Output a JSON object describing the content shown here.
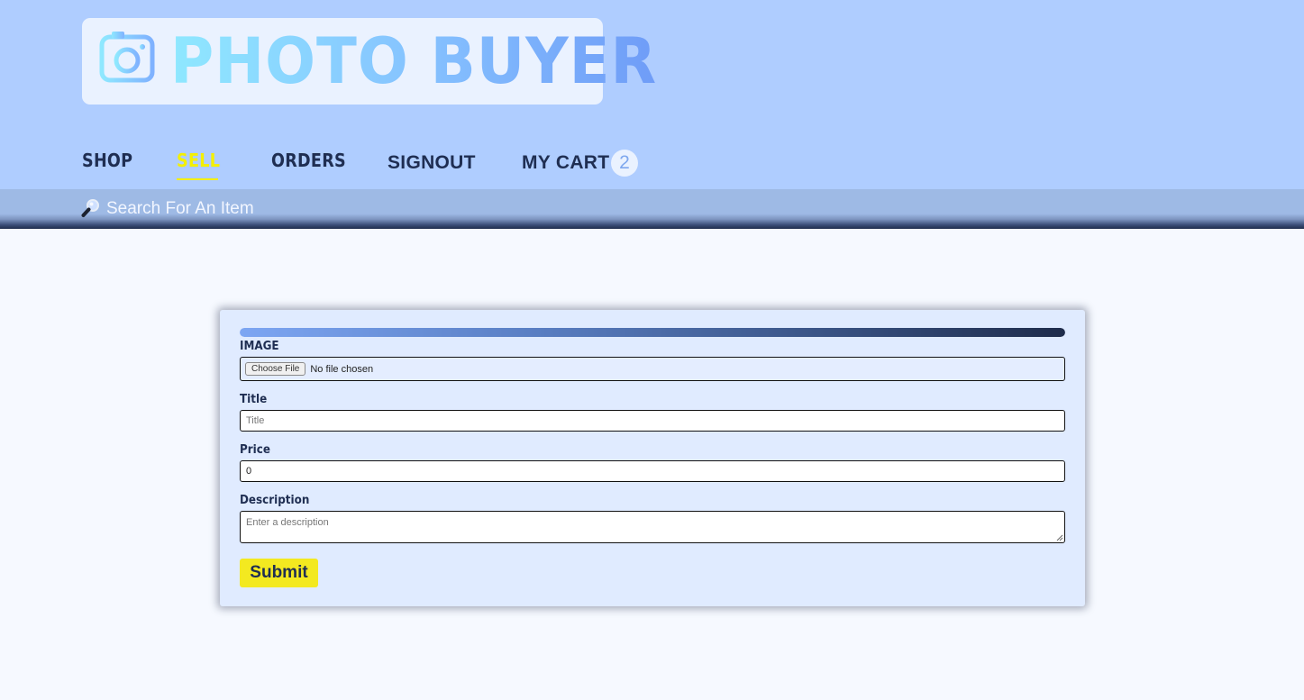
{
  "brand": {
    "name": "PHOTO BUYER",
    "icon": "camera-icon"
  },
  "nav": {
    "shop": "SHOP",
    "sell": "SELL",
    "orders": "ORDERS",
    "signout": "SIGNOUT",
    "cart": "MY CART",
    "cart_count": "2",
    "active": "SELL"
  },
  "search": {
    "icon": "magnifier-icon",
    "placeholder": "Search For An Item"
  },
  "form": {
    "progress": 1.0,
    "image_label": "IMAGE",
    "file_button": "Choose File",
    "file_status": "No file chosen",
    "title_label": "Title",
    "title_placeholder": "Title",
    "title_value": "",
    "price_label": "Price",
    "price_value": "0",
    "description_label": "Description",
    "description_placeholder": "Enter a description",
    "submit_label": "Submit"
  },
  "colors": {
    "header_bg": "#afcdff",
    "accent_yellow": "#f4f000",
    "nav_text": "#1f2e52",
    "card_bg": "#e0ebff"
  }
}
